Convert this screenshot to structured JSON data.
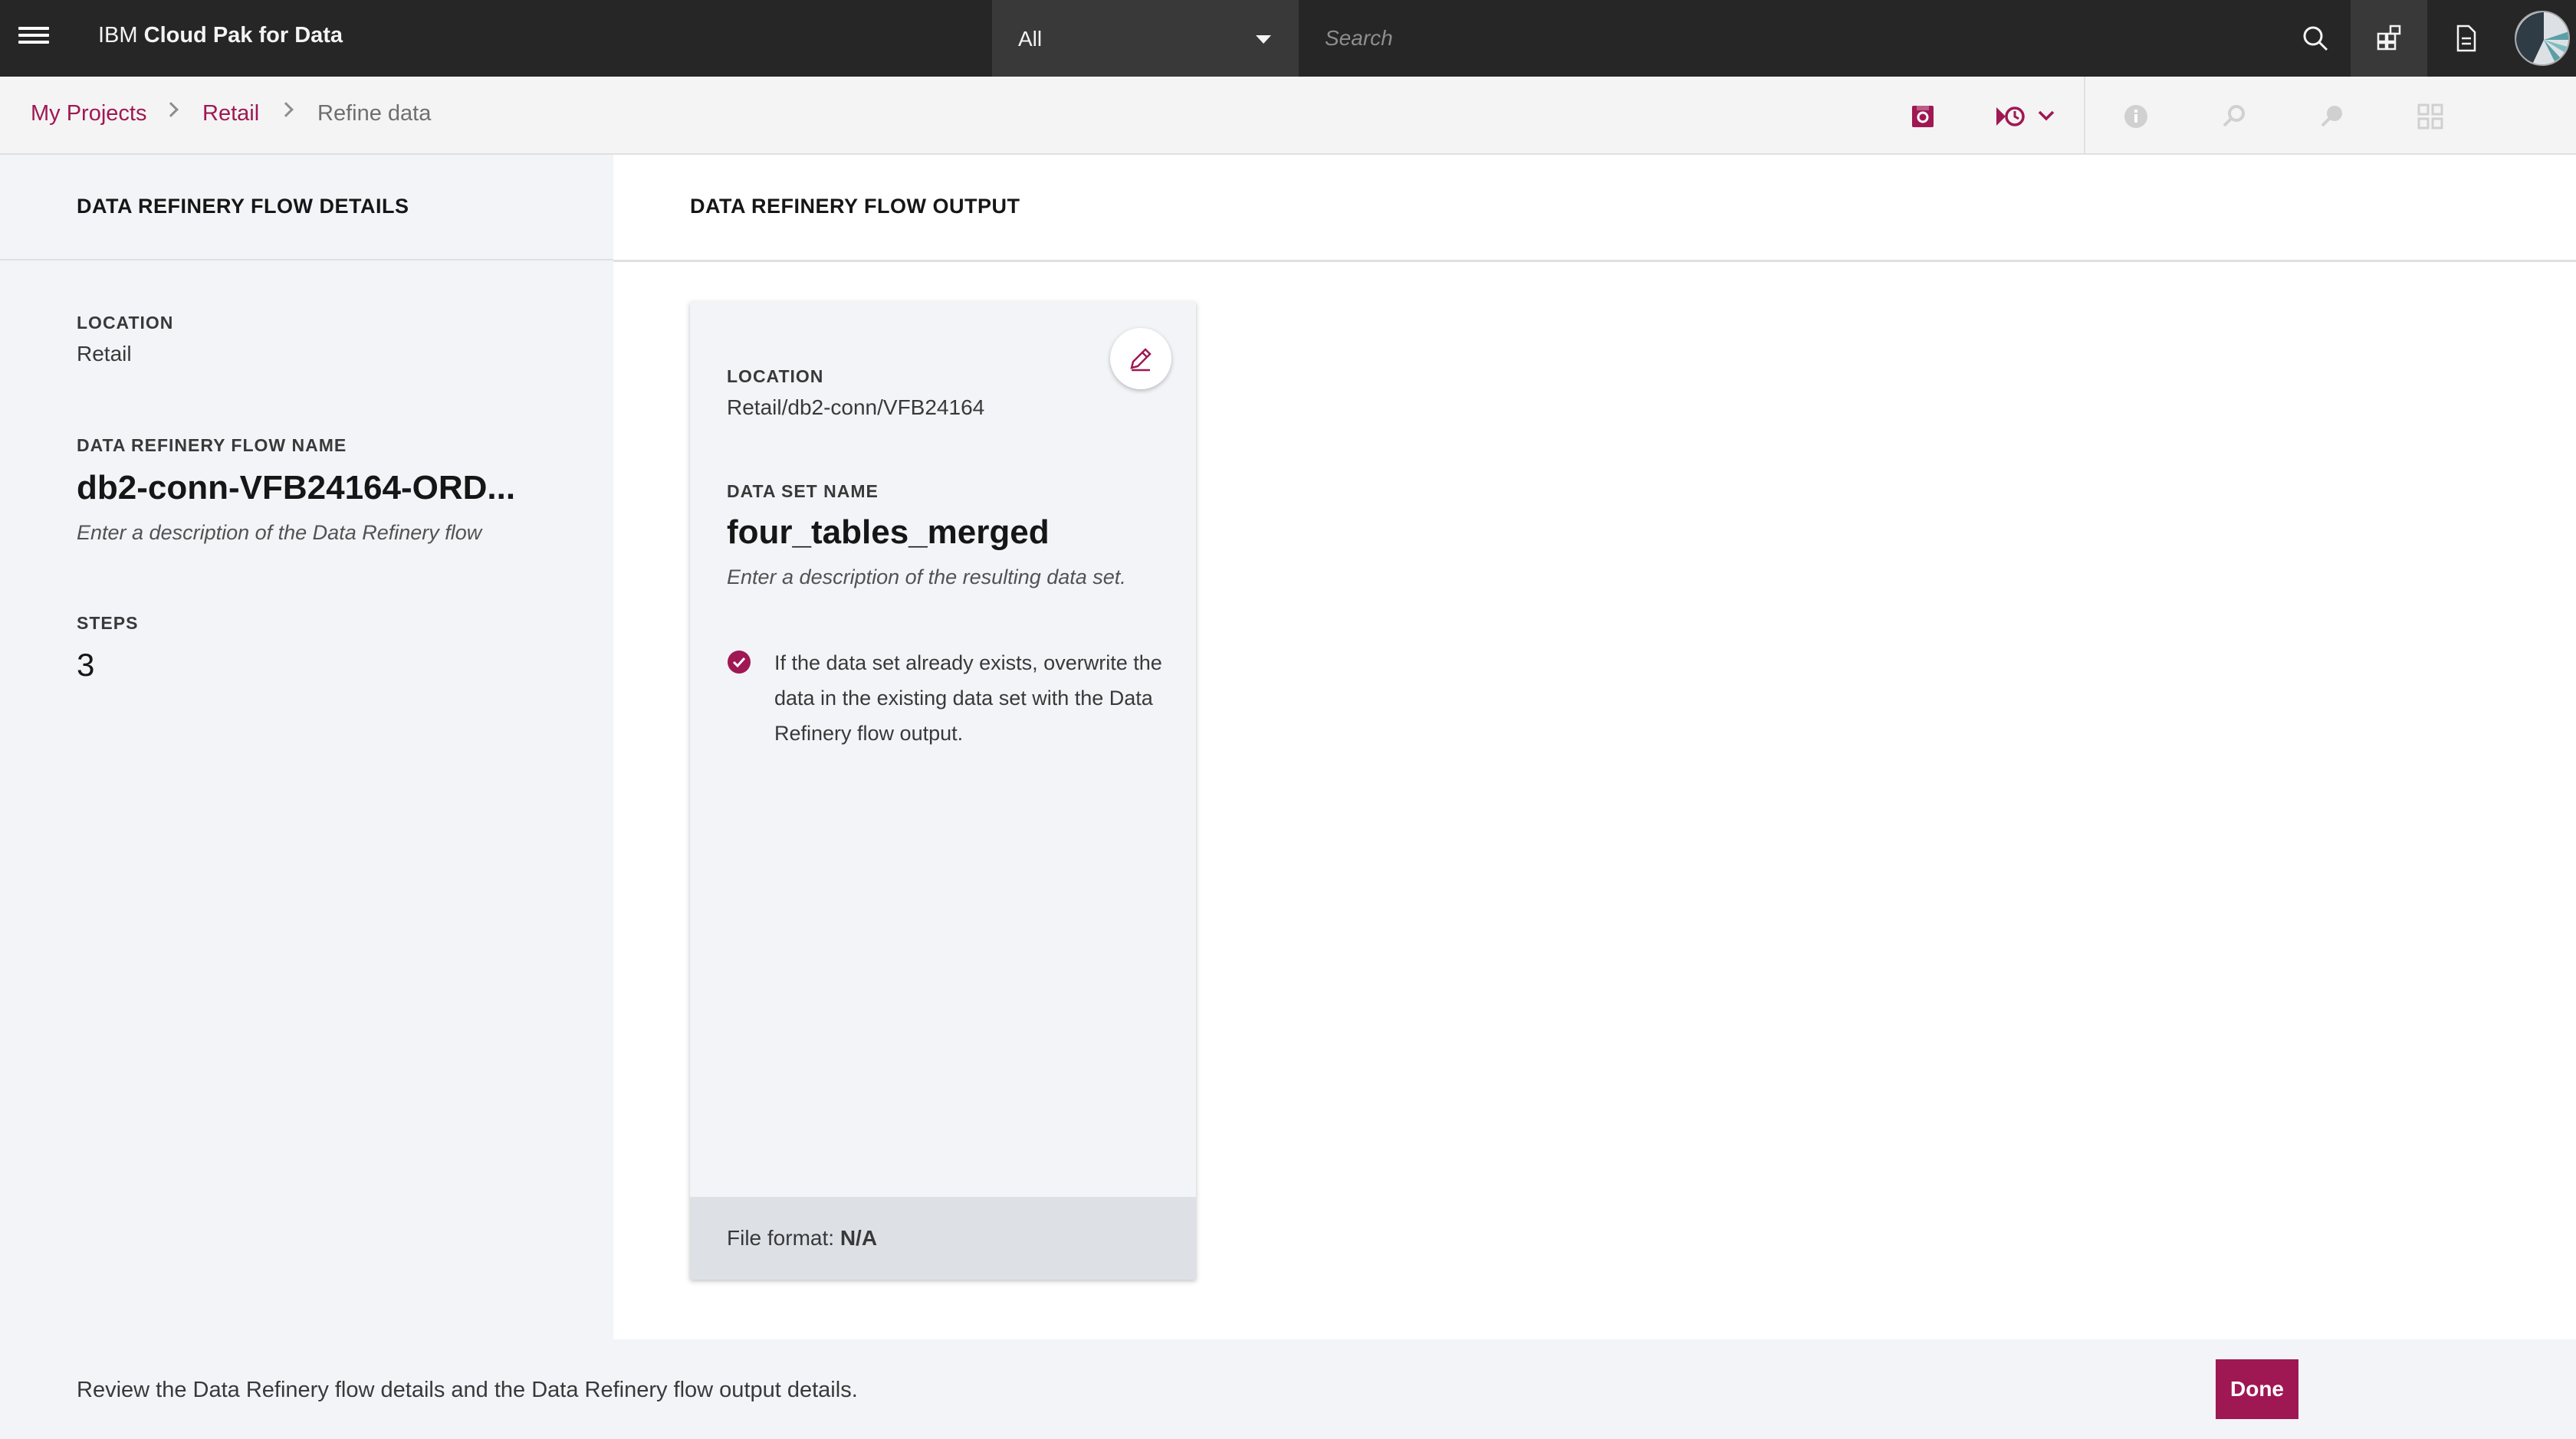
{
  "header": {
    "brand_prefix": "IBM",
    "brand_name": "Cloud Pak for Data",
    "scope_selected": "All",
    "search_placeholder": "Search",
    "icons": [
      "menu-icon",
      "search-icon",
      "catalog-icon",
      "document-icon",
      "avatar"
    ]
  },
  "breadcrumb": {
    "items": [
      "My Projects",
      "Retail",
      "Refine data"
    ]
  },
  "toolbar": {
    "icons": [
      "save-icon",
      "schedule-run-icon",
      "info-icon",
      "search-replace-icon",
      "profile-icon",
      "grid-icon"
    ]
  },
  "details": {
    "title": "DATA REFINERY FLOW DETAILS",
    "location_label": "LOCATION",
    "location_value": "Retail",
    "flow_name_label": "DATA REFINERY FLOW NAME",
    "flow_name_value": "db2-conn-VFB24164-ORD...",
    "flow_description_placeholder": "Enter a description of the Data Refinery flow",
    "steps_label": "STEPS",
    "steps_value": "3"
  },
  "output": {
    "title": "DATA REFINERY FLOW OUTPUT",
    "location_label": "LOCATION",
    "location_value": "Retail/db2-conn/VFB24164",
    "dataset_label": "DATA SET NAME",
    "dataset_value": "four_tables_merged",
    "dataset_description_placeholder": "Enter a description of the resulting data set.",
    "overwrite_text": "If the data set already exists, overwrite the data in the existing data set with the Data Refinery flow output.",
    "file_format_label": "File format:",
    "file_format_value": "N/A"
  },
  "footer": {
    "message": "Review the Data Refinery flow details and the Data Refinery flow output details.",
    "done_label": "Done"
  },
  "colors": {
    "accent": "#9f1853",
    "topbar": "#262626",
    "panel": "#f2f4f8"
  }
}
